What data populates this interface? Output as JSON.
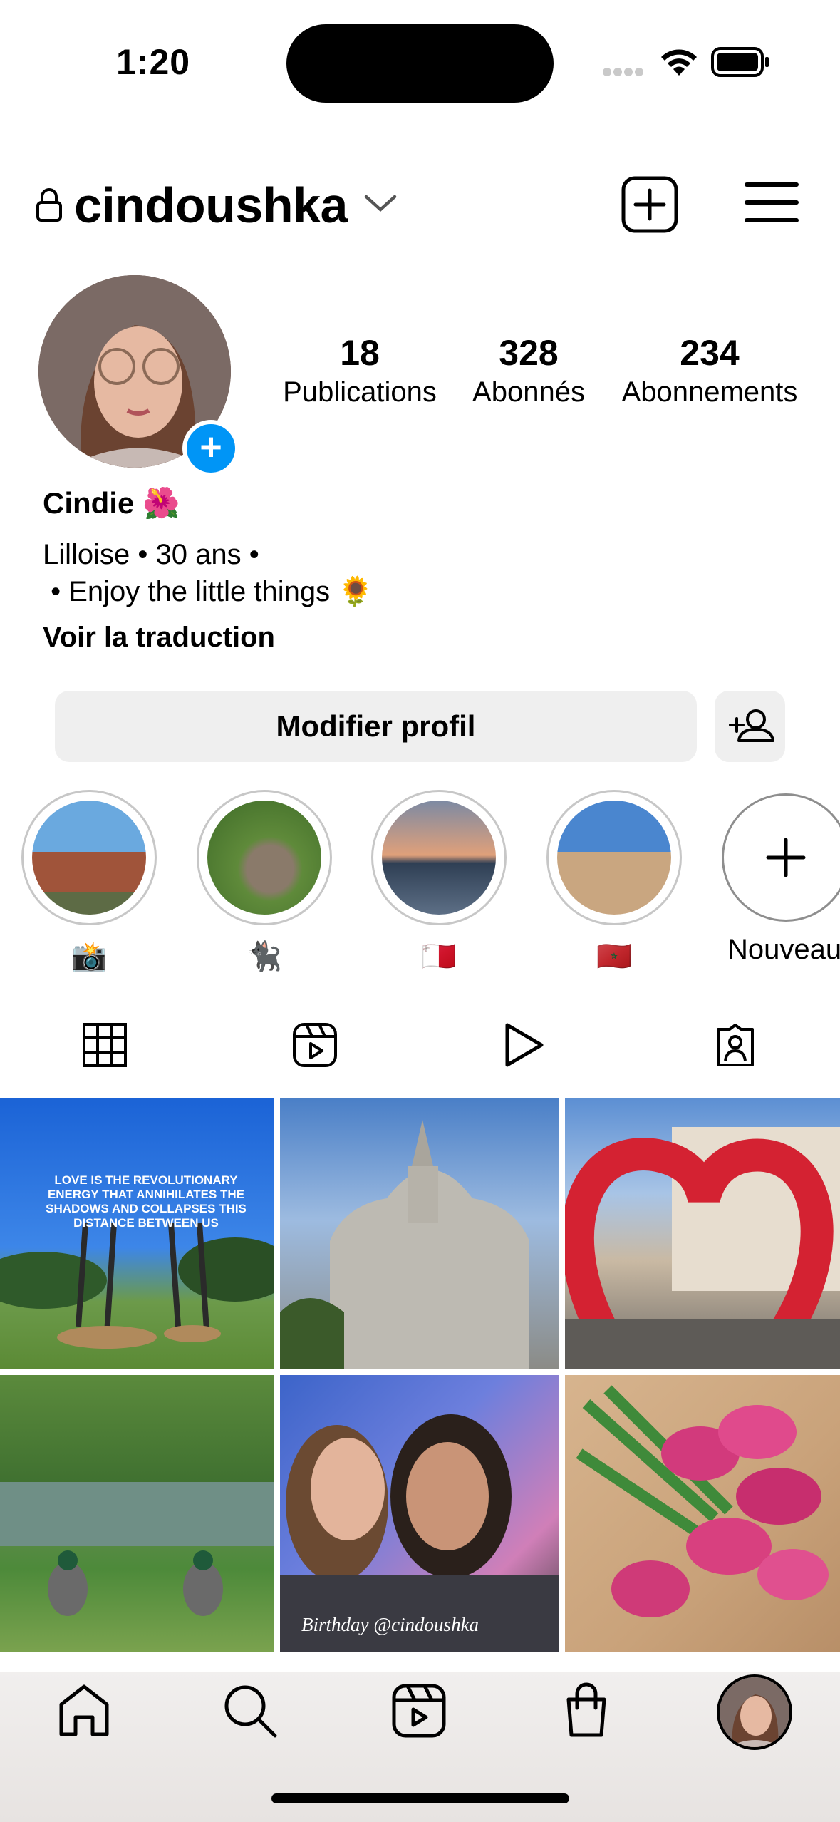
{
  "status_bar": {
    "time": "1:20"
  },
  "header": {
    "username": "cindoushka"
  },
  "stats": [
    {
      "count": "18",
      "label": "Publications"
    },
    {
      "count": "328",
      "label": "Abonnés"
    },
    {
      "count": "234",
      "label": "Abonnements"
    }
  ],
  "bio": {
    "name": "Cindie 🌺",
    "line1": "Lilloise • 30 ans •",
    "line2": " • Enjoy the little things 🌻",
    "translate": "Voir la traduction"
  },
  "buttons": {
    "edit_profile": "Modifier profil"
  },
  "highlights": [
    {
      "label": "📸"
    },
    {
      "label": "🐈‍⬛"
    },
    {
      "label": "🇲🇹"
    },
    {
      "label": "🇲🇦"
    },
    {
      "label": "Nouveau"
    }
  ],
  "grid": {
    "post1_caption": "LOVE IS THE REVOLUTIONARY ENERGY THAT ANNIHILATES THE SHADOWS AND COLLAPSES THIS DISTANCE BETWEEN US",
    "post5_caption": "Birthday @cindoushka"
  },
  "colors": {
    "accent": "#0095f6",
    "button_bg": "#efefef"
  }
}
